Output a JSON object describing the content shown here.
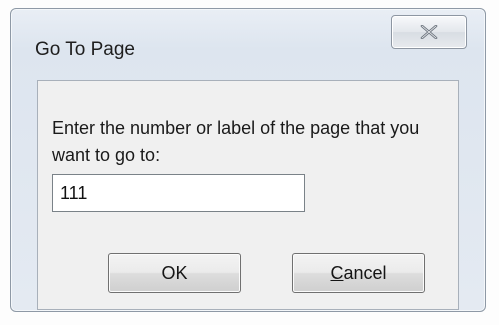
{
  "window": {
    "title": "Go To Page",
    "close_icon": "close-icon"
  },
  "dialog": {
    "prompt": "Enter the number or label of the page that you want to go to:",
    "page_input_value": "111"
  },
  "buttons": {
    "ok_label": "OK",
    "cancel_accelerator": "C",
    "cancel_rest": "ancel"
  },
  "colors": {
    "frame": "#dde5ef",
    "client": "#f0f0f0",
    "input_bg": "#ffffff"
  }
}
